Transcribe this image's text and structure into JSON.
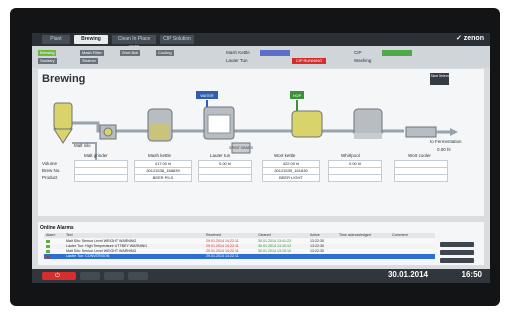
{
  "brand": "zenon",
  "topbar": {
    "tabs": [
      "Plant",
      "Brewing",
      "Clean In Place (CIP)",
      "CIP Solution"
    ]
  },
  "subbar": {
    "items": [
      "Brewing",
      "Mash Filter",
      "Wort Boil",
      "Cooling",
      "Sanitary",
      "Strainer",
      "Lauter Tun",
      "Whirlpool"
    ],
    "status_left": "Mash Kettle",
    "status_mid": "Lauter Tun",
    "status_right": "CIP",
    "status_chip": "CIP RUNNING",
    "status_box_red": "Washing"
  },
  "page": {
    "title": "Brewing",
    "start_label": "Start Select"
  },
  "labels": {
    "malt_silo": "Malt silo",
    "water": "WATER",
    "hop": "HOP",
    "spent_grains": "SPENT GRAINS",
    "to_fermentation": "to Fermentation",
    "fermentation_value": "0.00 hl"
  },
  "equipment_table": {
    "headers": [
      "Malt grinder",
      "Mash kettle",
      "Lauter tun",
      "Wort kettle",
      "Whirlpool",
      "Wort cooler"
    ],
    "rows": [
      [
        "",
        "417.00 hl",
        "0.00 hl",
        "422.00 hl",
        "0.00 hl",
        ""
      ],
      [
        "",
        "30121538_168839",
        "",
        "30121539_161830",
        "",
        ""
      ],
      [
        "",
        "BEER PILS",
        "",
        "BEER LIGHT",
        "",
        ""
      ]
    ],
    "row_labels": [
      "Volume",
      "Brew No.",
      "Product"
    ]
  },
  "alarms": {
    "title": "Online Alarms",
    "headers": [
      "Alarm",
      "Text",
      "Received",
      "Cleared",
      "Active",
      "Time acknowledged",
      "Comment"
    ],
    "rows": [
      {
        "text": "Malt Silo: Sensor Level WEIGHT WARNING",
        "received": "29.01.2014 14:22:11",
        "cleared": "30.01.2014 13:41:23",
        "active": "13:22:30"
      },
      {
        "text": "Lauter Tun: High Temperature UTTBEY WARNING",
        "received": "29.01.2014 14:22:11",
        "cleared": "30.01.2014 13:10:12",
        "active": "13:22:30"
      },
      {
        "text": "Malt Silo: Sensor Level WEIGHT WARNING",
        "received": "29.01.2014 14:22:11",
        "cleared": "30.01.2014 13:15:10",
        "active": "13:22:30"
      },
      {
        "text": "Lauter Tun: CONVERSION",
        "received": "29.01.2014 14:22:11",
        "cleared": "",
        "active": ""
      }
    ]
  },
  "footer": {
    "date": "30.01.2014",
    "time": "16:50"
  }
}
